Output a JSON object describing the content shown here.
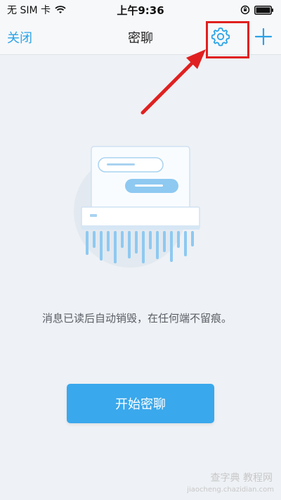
{
  "status_bar": {
    "carrier": "无 SIM 卡",
    "time": "上午9:36"
  },
  "nav": {
    "close_label": "关闭",
    "title": "密聊"
  },
  "main": {
    "description": "消息已读后自动销毁，在任何端不留痕。",
    "start_button_label": "开始密聊"
  },
  "watermark": {
    "site": "查字典 教程网",
    "url": "jiaocheng.chazidian.com"
  },
  "icons": {
    "settings": "gear-icon",
    "add": "plus-icon",
    "wifi": "wifi-icon",
    "lock": "orientation-lock-icon",
    "battery": "battery-icon"
  },
  "colors": {
    "accent": "#2aa3e6",
    "button": "#3aa8ec",
    "highlight": "#e02020"
  }
}
